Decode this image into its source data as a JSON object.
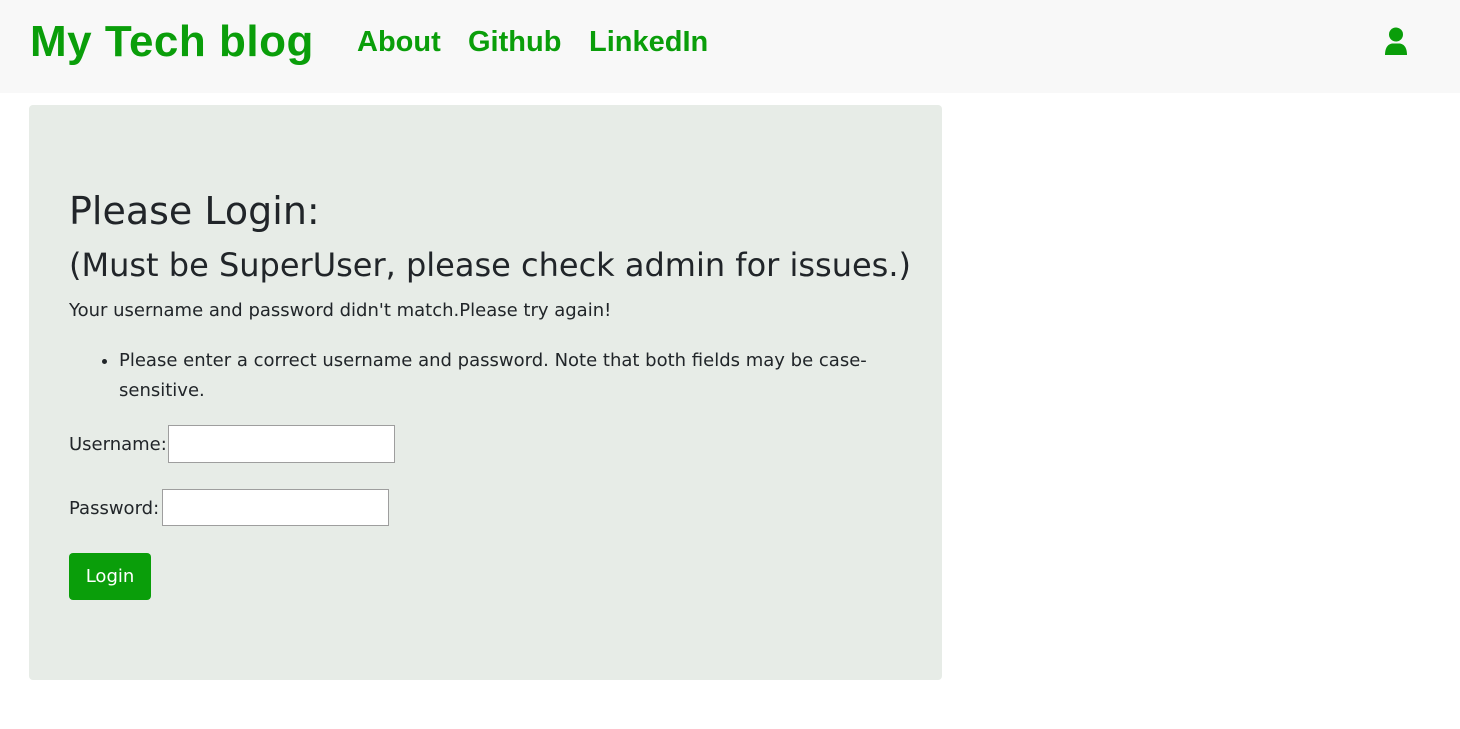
{
  "navbar": {
    "brand": "My Tech blog",
    "links": [
      {
        "label": "About"
      },
      {
        "label": "Github"
      },
      {
        "label": "LinkedIn"
      }
    ],
    "user_icon": "user-icon"
  },
  "login": {
    "heading": "Please Login:",
    "subheading": "(Must be SuperUser, please check admin for issues.)",
    "error_message": "Your username and password didn't match.Please try again!",
    "error_list": [
      "Please enter a correct username and password. Note that both fields may be case-sensitive."
    ],
    "username_label": "Username:",
    "username_value": "",
    "password_label": "Password:",
    "password_value": "",
    "submit_label": "Login"
  },
  "colors": {
    "accent": "#0a9e0a",
    "navbar_bg": "#f8f8f8",
    "panel_bg": "#e7ece7",
    "text": "#212529"
  }
}
